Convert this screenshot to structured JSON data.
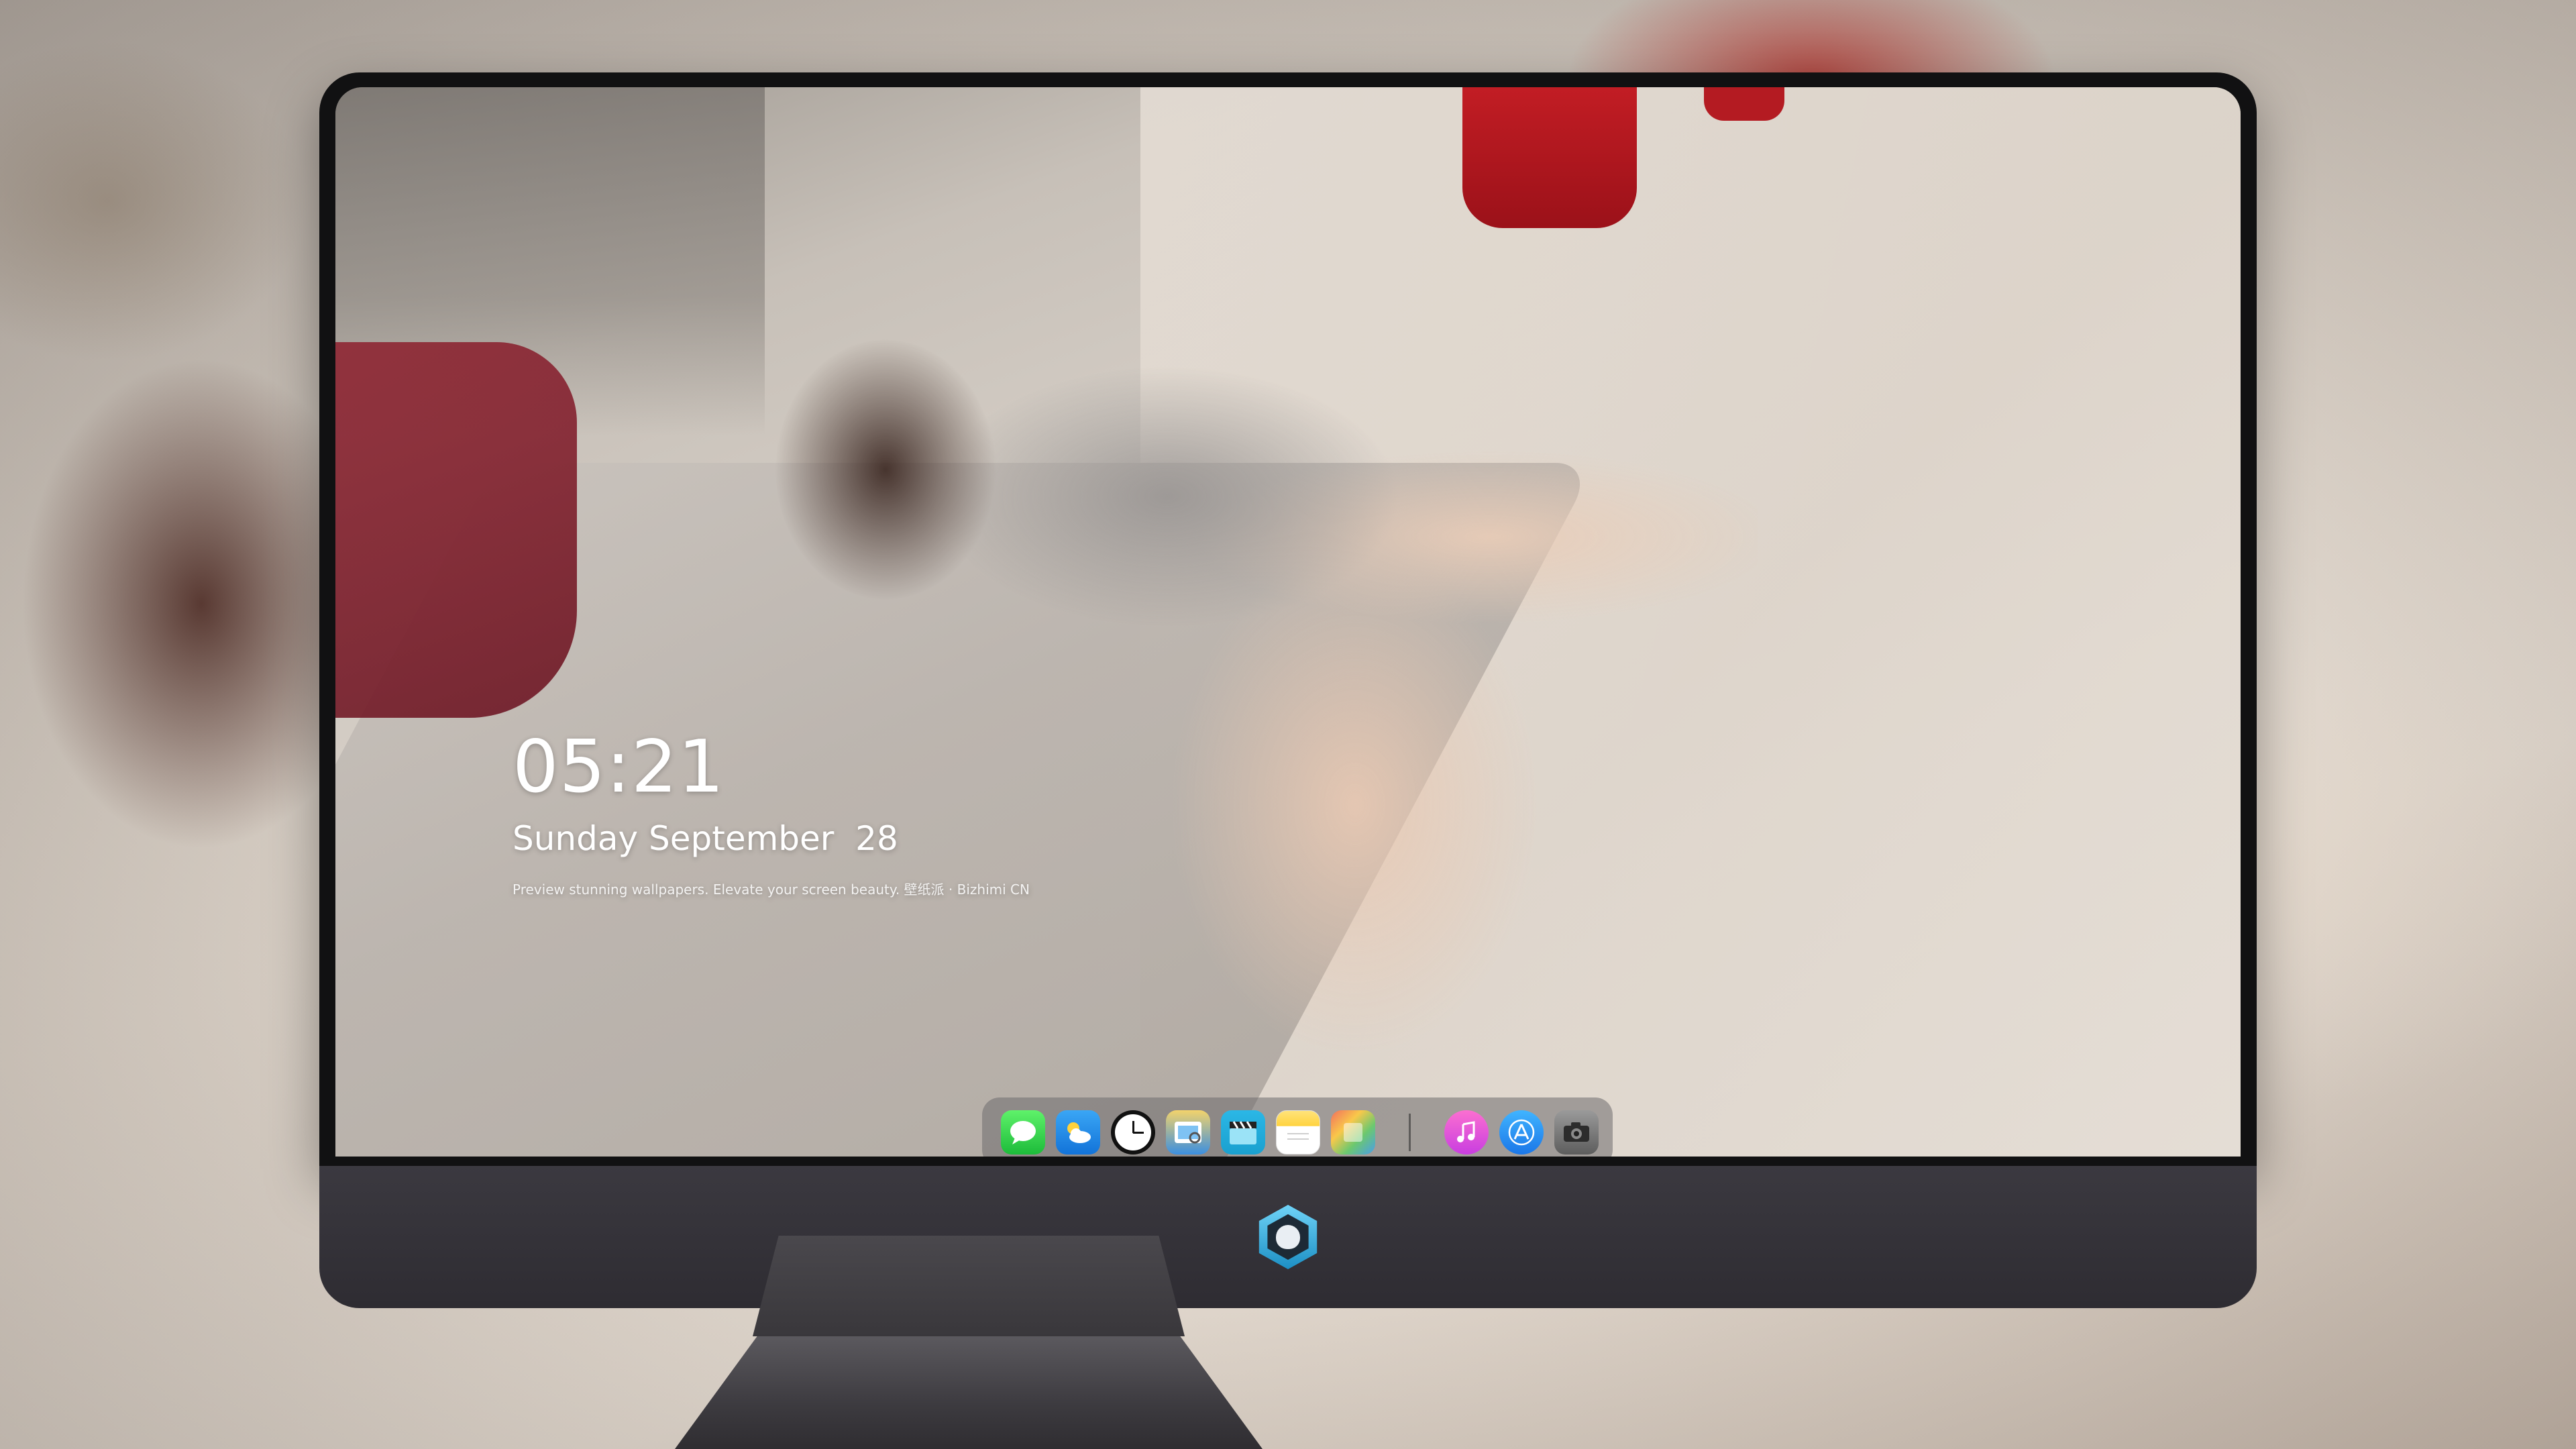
{
  "lock_screen": {
    "time": "05:21",
    "date": "Sunday September  28",
    "tagline": "Preview stunning wallpapers. Elevate your screen beauty. 壁纸派 · Bizhimi CN"
  },
  "dock": {
    "apps": [
      {
        "name": "messages",
        "icon": "messages-icon",
        "color": "#2fd14a"
      },
      {
        "name": "weather",
        "icon": "weather-icon",
        "color": "#1f8ae8"
      },
      {
        "name": "clock",
        "icon": "clock-icon",
        "color": "#111111"
      },
      {
        "name": "preview",
        "icon": "preview-icon",
        "color": "#3b8fe0"
      },
      {
        "name": "clapper",
        "icon": "clapper-icon",
        "color": "#21acdb"
      },
      {
        "name": "notes",
        "icon": "notes-icon",
        "color": "#ffd33f"
      },
      {
        "name": "photos",
        "icon": "photos-icon",
        "color": "#6cc86f"
      },
      {
        "name": "music",
        "icon": "music-icon",
        "color": "#e055d8"
      },
      {
        "name": "app-store",
        "icon": "app-store-icon",
        "color": "#1b88f0"
      },
      {
        "name": "camera",
        "icon": "camera-icon",
        "color": "#6d6d6d"
      }
    ]
  },
  "device": {
    "chin_logo": "logo-icon",
    "accent": "#1c8fc4"
  }
}
